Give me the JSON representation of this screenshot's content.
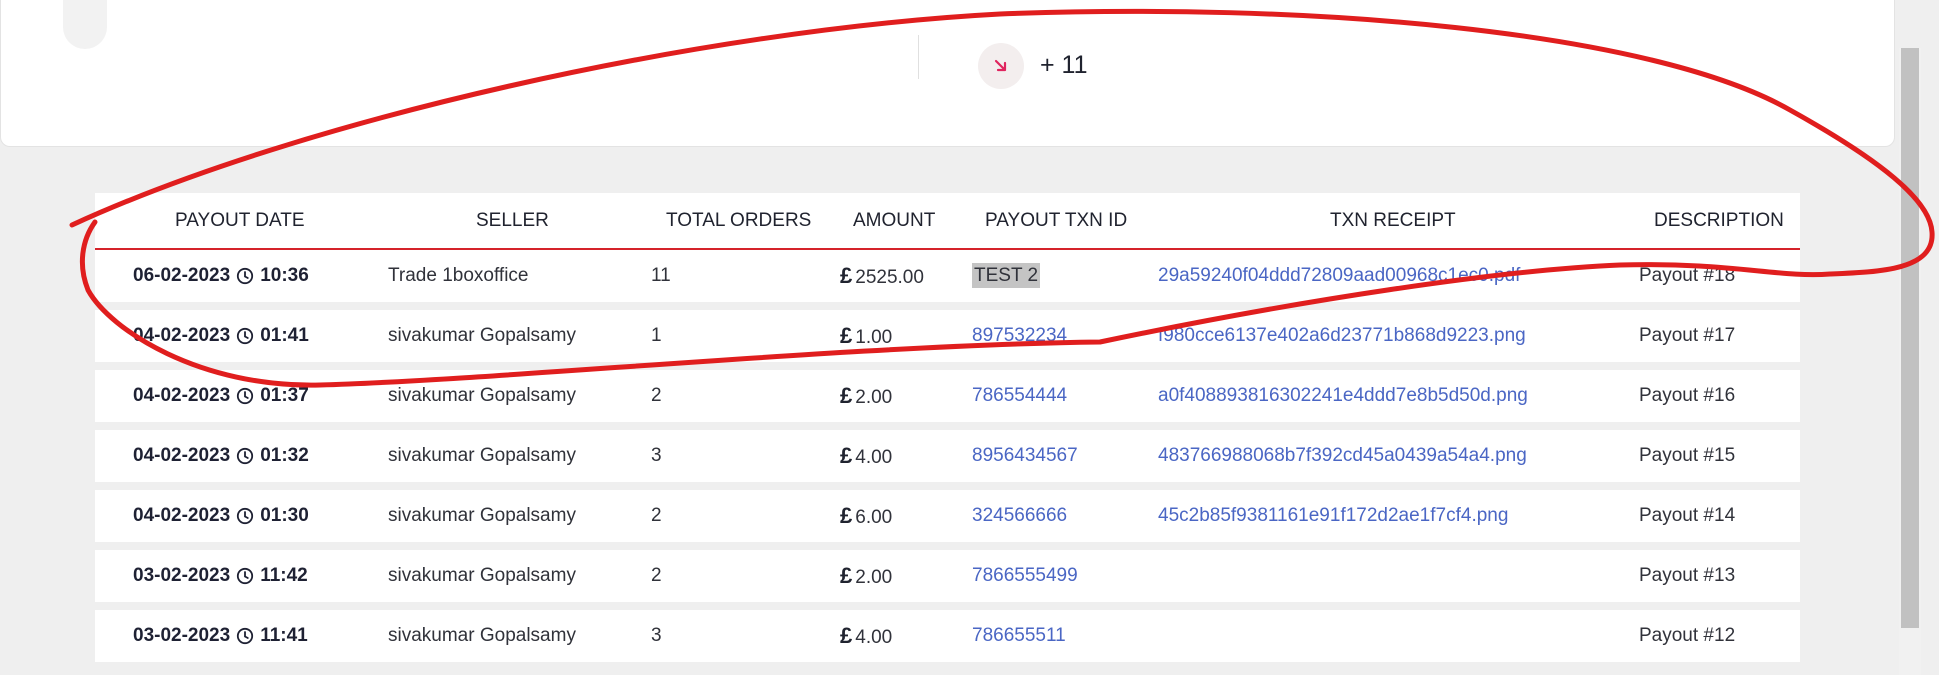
{
  "stats": {
    "value": "+ 11",
    "icon": "arrow-down-right-icon",
    "icon_color": "#e0245e"
  },
  "table": {
    "headers": {
      "payout_date": "PAYOUT DATE",
      "seller": "SELLER",
      "total_orders": "TOTAL ORDERS",
      "amount": "AMOUNT",
      "payout_txn_id": "PAYOUT TXN ID",
      "txn_receipt": "TXN RECEIPT",
      "description": "DESCRIPTION"
    },
    "rows": [
      {
        "date": "06-02-2023",
        "time": "10:36",
        "seller": "Trade 1boxoffice",
        "orders": "11",
        "currency": "£",
        "amount": "2525.00",
        "txn_id": "TEST 2",
        "receipt": "29a59240f04ddd72809aad00968c1ec0.pdf",
        "description": "Payout #18"
      },
      {
        "date": "04-02-2023",
        "time": "01:41",
        "seller": "sivakumar Gopalsamy",
        "orders": "1",
        "currency": "£",
        "amount": "1.00",
        "txn_id": "897532234",
        "receipt": "f980cce6137e402a6d23771b868d9223.png",
        "description": "Payout #17"
      },
      {
        "date": "04-02-2023",
        "time": "01:37",
        "seller": "sivakumar Gopalsamy",
        "orders": "2",
        "currency": "£",
        "amount": "2.00",
        "txn_id": "786554444",
        "receipt": "a0f408893816302241e4ddd7e8b5d50d.png",
        "description": "Payout #16"
      },
      {
        "date": "04-02-2023",
        "time": "01:32",
        "seller": "sivakumar Gopalsamy",
        "orders": "3",
        "currency": "£",
        "amount": "4.00",
        "txn_id": "8956434567",
        "receipt": "483766988068b7f392cd45a0439a54a4.png",
        "description": "Payout #15"
      },
      {
        "date": "04-02-2023",
        "time": "01:30",
        "seller": "sivakumar Gopalsamy",
        "orders": "2",
        "currency": "£",
        "amount": "6.00",
        "txn_id": "324566666",
        "receipt": "45c2b85f9381161e91f172d2ae1f7cf4.png",
        "description": "Payout #14"
      },
      {
        "date": "03-02-2023",
        "time": "11:42",
        "seller": "sivakumar Gopalsamy",
        "orders": "2",
        "currency": "£",
        "amount": "2.00",
        "txn_id": "7866555499",
        "receipt": "",
        "description": "Payout #13"
      },
      {
        "date": "03-02-2023",
        "time": "11:41",
        "seller": "sivakumar Gopalsamy",
        "orders": "3",
        "currency": "£",
        "amount": "4.00",
        "txn_id": "786655511",
        "receipt": "",
        "description": "Payout #12"
      }
    ]
  },
  "colors": {
    "accent_red": "#d5232a",
    "link_blue": "#4a66c4",
    "annotation_red": "#e01e1e"
  }
}
